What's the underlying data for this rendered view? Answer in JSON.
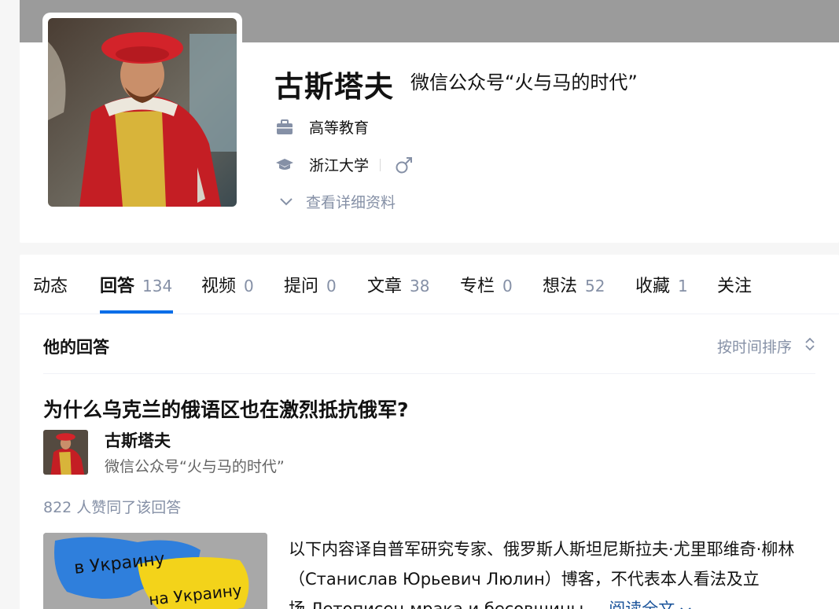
{
  "profile": {
    "name": "古斯塔夫",
    "headline": "微信公众号“火与马的时代”",
    "industry": "高等教育",
    "school": "浙江大学",
    "details_toggle": "查看详细资料"
  },
  "tabs": [
    {
      "label": "动态",
      "count": ""
    },
    {
      "label": "回答",
      "count": "134"
    },
    {
      "label": "视频",
      "count": "0"
    },
    {
      "label": "提问",
      "count": "0"
    },
    {
      "label": "文章",
      "count": "38"
    },
    {
      "label": "专栏",
      "count": "0"
    },
    {
      "label": "想法",
      "count": "52"
    },
    {
      "label": "收藏",
      "count": "1"
    },
    {
      "label": "关注",
      "count": ""
    }
  ],
  "active_tab": "回答",
  "answers_section": {
    "title": "他的回答",
    "sort_label": "按时间排序"
  },
  "answer": {
    "question": "为什么乌克兰的俄语区也在激烈抵抗俄军?",
    "author_name": "古斯塔夫",
    "author_headline": "微信公众号“火与马的时代”",
    "votes": "822 人赞同了该回答",
    "excerpt": "以下内容译自普军研究专家、俄罗斯人斯坦尼斯拉夫·尤里耶维奇·柳林（Станислав Юрьевич Люлин）博客，不代表本人看法及立场.Летописец мрака и бесовщины...",
    "read_more": "阅读全文",
    "thumb_text_1": "в Украину",
    "thumb_text_2": "на Украину"
  },
  "colors": {
    "accent": "#056de8",
    "muted": "#8590a6",
    "link": "#175199",
    "cover": "#9b9b9b"
  },
  "icons": [
    "briefcase-icon",
    "graduation-cap-icon",
    "male-gender-icon",
    "chevron-down-icon",
    "sort-icon"
  ]
}
